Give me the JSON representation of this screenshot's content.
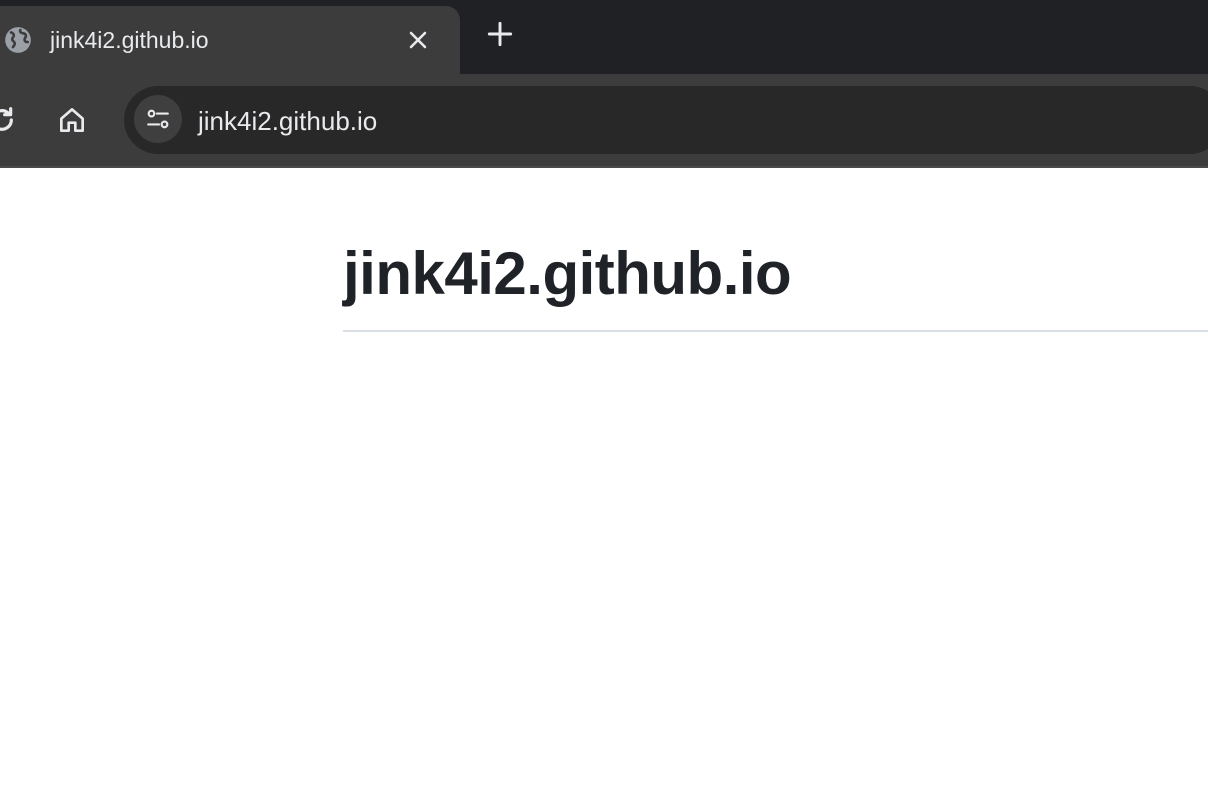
{
  "tab": {
    "title": "jink4i2.github.io",
    "favicon": "globe-icon",
    "close_icon": "close-icon"
  },
  "tabstrip": {
    "new_tab_icon": "plus-icon"
  },
  "toolbar": {
    "reload_icon": "reload-icon",
    "home_icon": "home-icon",
    "site_info_icon": "tune-icon"
  },
  "omnibox": {
    "url": "jink4i2.github.io"
  },
  "page": {
    "heading": "jink4i2.github.io"
  },
  "colors": {
    "tabstrip_bg": "#202124",
    "active_tab_bg": "#3c3c3c",
    "omnibox_bg": "#282828",
    "heading_text": "#1f2328",
    "rule": "#d8dee4"
  }
}
